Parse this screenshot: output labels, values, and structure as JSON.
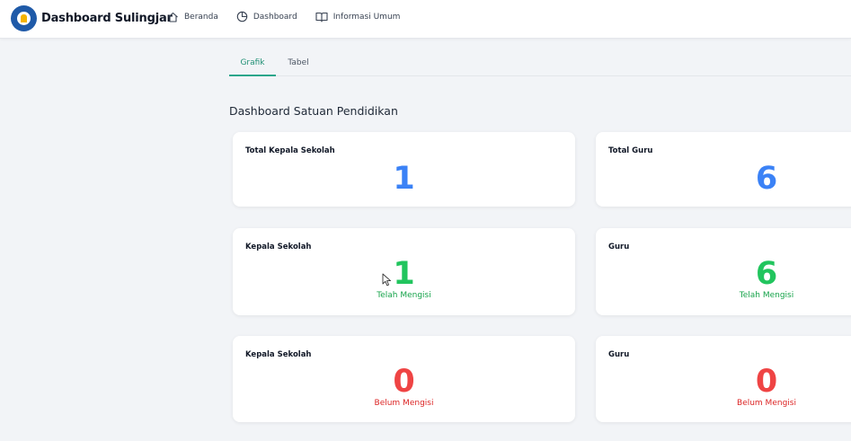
{
  "header": {
    "brand": "Dashboard Sulingjar",
    "nav": [
      {
        "label": "Beranda",
        "icon": "home-icon"
      },
      {
        "label": "Dashboard",
        "icon": "pie-chart-icon"
      },
      {
        "label": "Informasi Umum",
        "icon": "book-icon"
      }
    ]
  },
  "tabs": [
    {
      "label": "Grafik",
      "active": true
    },
    {
      "label": "Tabel",
      "active": false
    }
  ],
  "section_title": "Dashboard Satuan Pendidikan",
  "cards": {
    "total_kepala": {
      "label": "Total Kepala Sekolah",
      "value": "1"
    },
    "total_guru": {
      "label": "Total Guru",
      "value": "6"
    },
    "kepala_mengisi": {
      "label": "Kepala Sekolah",
      "value": "1",
      "sub": "Telah Mengisi"
    },
    "guru_mengisi": {
      "label": "Guru",
      "value": "6",
      "sub": "Telah Mengisi"
    },
    "kepala_belum": {
      "label": "Kepala Sekolah",
      "value": "0",
      "sub": "Belum Mengisi"
    },
    "guru_belum": {
      "label": "Guru",
      "value": "0",
      "sub": "Belum Mengisi"
    }
  },
  "colors": {
    "accent": "#2ba68a",
    "blue": "#3b82f6",
    "green": "#22c55e",
    "red": "#ef4444",
    "background": "#f2f4f7"
  }
}
